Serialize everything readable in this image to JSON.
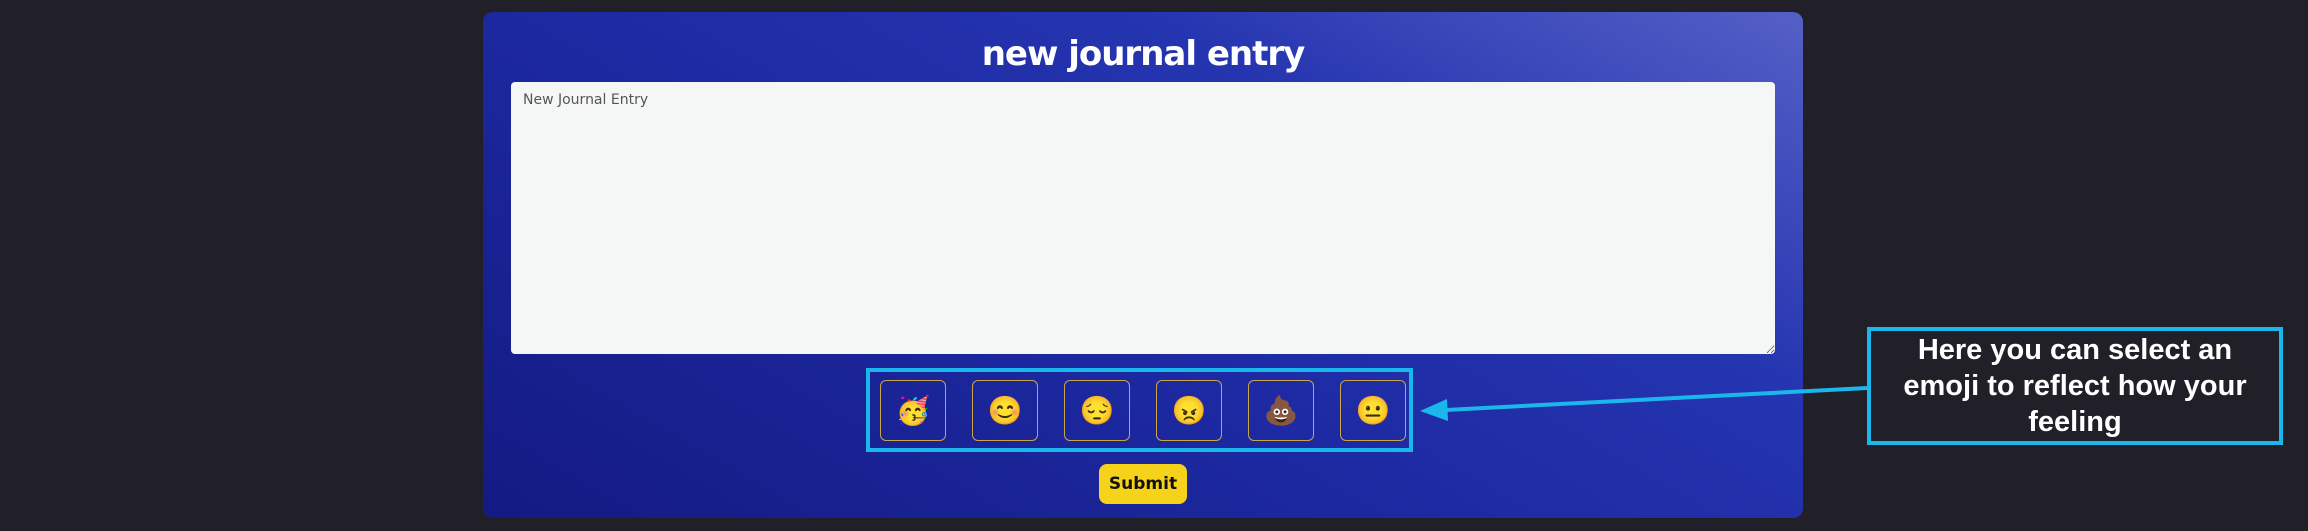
{
  "form": {
    "title": "new journal entry",
    "textarea_placeholder": "New Journal Entry",
    "submit_label": "Submit"
  },
  "emojis": [
    {
      "name": "partying-face",
      "glyph": "🥳"
    },
    {
      "name": "smiling-face",
      "glyph": "😊"
    },
    {
      "name": "pensive-face",
      "glyph": "😔"
    },
    {
      "name": "angry-face",
      "glyph": "😠"
    },
    {
      "name": "pile-of-poo",
      "glyph": "💩"
    },
    {
      "name": "neutral-face",
      "glyph": "😐"
    }
  ],
  "annotation": {
    "callout_text": "Here you can select an emoji to reflect how your feeling",
    "color": "#1bb7ec"
  },
  "colors": {
    "background": "#211f28",
    "submit": "#f7d21a",
    "emoji_border": "#c9a44a"
  }
}
